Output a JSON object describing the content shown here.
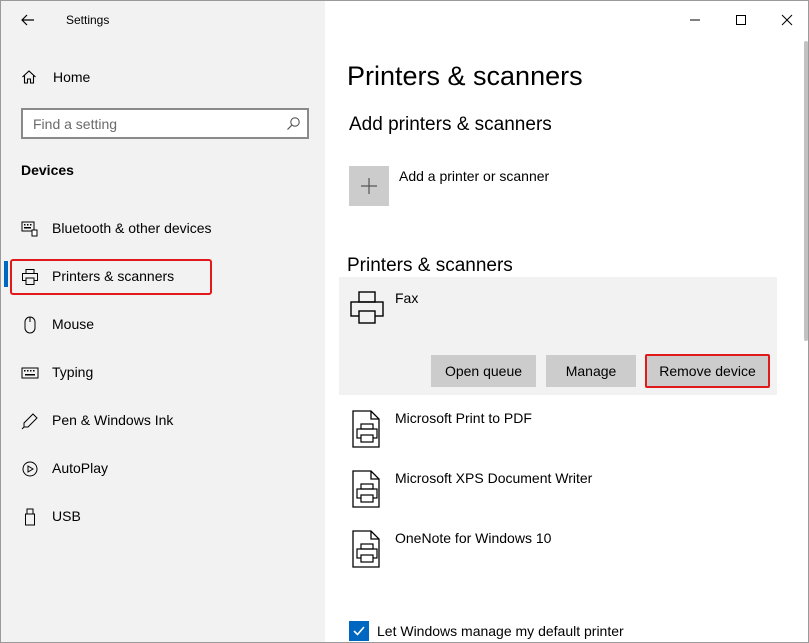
{
  "window": {
    "title": "Settings"
  },
  "sidebar": {
    "home_label": "Home",
    "search": {
      "placeholder": "Find a setting"
    },
    "section_heading": "Devices",
    "items": [
      {
        "label": "Bluetooth & other devices",
        "icon": "bluetooth-keyboard-icon"
      },
      {
        "label": "Printers & scanners",
        "icon": "printer-icon",
        "selected": true
      },
      {
        "label": "Mouse",
        "icon": "mouse-icon"
      },
      {
        "label": "Typing",
        "icon": "keyboard-icon"
      },
      {
        "label": "Pen & Windows Ink",
        "icon": "pen-icon"
      },
      {
        "label": "AutoPlay",
        "icon": "autoplay-icon"
      },
      {
        "label": "USB",
        "icon": "usb-icon"
      }
    ]
  },
  "main": {
    "title": "Printers & scanners",
    "add_section": {
      "heading": "Add printers & scanners",
      "add_label": "Add a printer or scanner"
    },
    "list_section": {
      "heading": "Printers & scanners",
      "selected_printer": {
        "name": "Fax",
        "buttons": {
          "open_queue": "Open queue",
          "manage": "Manage",
          "remove": "Remove device"
        }
      },
      "printers": [
        {
          "name": "Microsoft Print to PDF"
        },
        {
          "name": "Microsoft XPS Document Writer"
        },
        {
          "name": "OneNote for Windows 10"
        }
      ]
    },
    "default_printer_checkbox": {
      "label": "Let Windows manage my default printer",
      "checked": true
    }
  },
  "colors": {
    "accent": "#0067c0",
    "highlight": "#e0191b",
    "sidebar_bg": "#f2f2f2",
    "button_bg": "#cccccc"
  }
}
